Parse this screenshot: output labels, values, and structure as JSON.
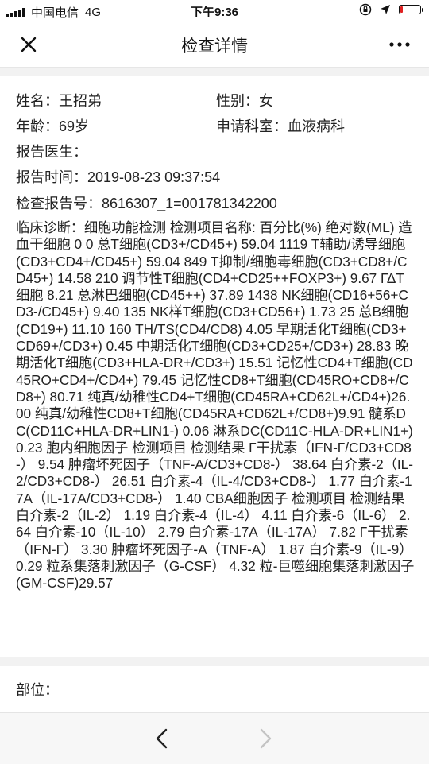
{
  "status_bar": {
    "carrier": "中国电信",
    "network": "4G",
    "time": "下午9:36",
    "battery_level": 0.12,
    "battery_color": "#e02020"
  },
  "nav": {
    "title": "检查详情",
    "close_icon": "close-icon",
    "more_icon": "more-icon"
  },
  "report": {
    "name_label": "姓名：",
    "name_value": "王招弟",
    "gender_label": "性别：",
    "gender_value": "女",
    "age_label": "年龄：",
    "age_value": "69岁",
    "dept_label": "申请科室：",
    "dept_value": "血液病科",
    "doctor_label": "报告医生：",
    "doctor_value": "",
    "time_label": "报告时间：",
    "time_value": "2019-08-23 09:37:54",
    "number_label": "检查报告号：",
    "number_value": "8616307_1=001781342200",
    "diagnosis_label": "临床诊断：",
    "diagnosis_text": "细胞功能检测 检测项目名称: 百分比(%) 绝对数(ML) 造血干细胞 0 0 总T细胞(CD3+/CD45+) 59.04 1119 T辅助/诱导细胞(CD3+CD4+/CD45+) 59.04 849 T抑制/细胞毒细胞(CD3+CD8+/CD45+) 14.58 210 调节性T细胞(CD4+CD25++FOXP3+) 9.67 ΓΔT细胞 8.21 总淋巴细胞(CD45++) 37.89 1438 NK细胞(CD16+56+CD3-/CD45+) 9.40 135 NK样T细胞(CD3+CD56+) 1.73 25 总B细胞(CD19+) 11.10 160 TH/TS(CD4/CD8) 4.05 早期活化T细胞(CD3+CD69+/CD3+) 0.45 中期活化T细胞(CD3+CD25+/CD3+) 28.83 晚期活化T细胞(CD3+HLA-DR+/CD3+) 15.51 记忆性CD4+T细胞(CD45RO+CD4+/CD4+) 79.45 记忆性CD8+T细胞(CD45RO+CD8+/CD8+) 80.71 纯真/幼稚性CD4+T细胞(CD45RA+CD62L+/CD4+)26.00 纯真/幼稚性CD8+T细胞(CD45RA+CD62L+/CD8+)9.91 髓系DC(CD11C+HLA-DR+LIN1-) 0.06 淋系DC(CD11C-HLA-DR+LIN1+) 0.23 胞内细胞因子 检测项目 检测结果 Γ干扰素（IFN-Γ/CD3+CD8-） 9.54 肿瘤坏死因子（TNF-A/CD3+CD8-） 38.64 白介素-2（IL-2/CD3+CD8-） 26.51 白介素-4（IL-4/CD3+CD8-） 1.77 白介素-17A（IL-17A/CD3+CD8-） 1.40 CBA细胞因子 检测项目 检测结果 白介素-2（IL-2） 1.19 白介素-4（IL-4） 4.11 白介素-6（IL-6） 2.64 白介素-10（IL-10） 2.79 白介素-17A（IL-17A） 7.82 Γ干扰素（IFN-Γ） 3.30 肿瘤坏死因子-A（TNF-A） 1.87 白介素-9（IL-9） 0.29 粒系集落刺激因子（G-CSF） 4.32 粒-巨噬细胞集落刺激因子(GM-CSF)29.57",
    "site_label": "部位："
  },
  "bottom_nav": {
    "back_icon": "chevron-left-icon",
    "forward_icon": "chevron-right-icon"
  }
}
